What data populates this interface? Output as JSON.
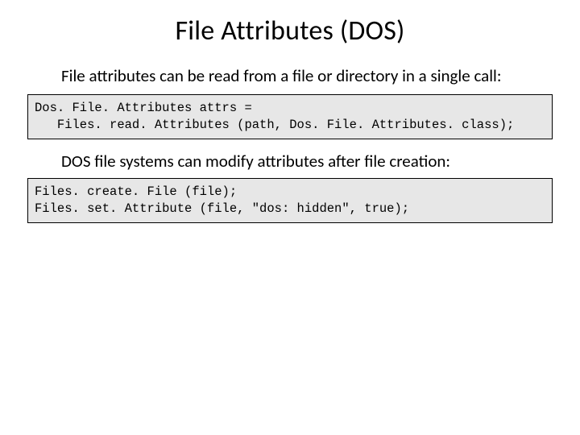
{
  "title": "File Attributes (DOS)",
  "intro": "File attributes can be read from a file or directory in a single call:",
  "code1": "Dos. File. Attributes attrs =\n   Files. read. Attributes (path, Dos. File. Attributes. class);",
  "mid": "DOS file systems can modify attributes after file creation:",
  "code2": "Files. create. File (file);\nFiles. set. Attribute (file, \"dos: hidden\", true);"
}
